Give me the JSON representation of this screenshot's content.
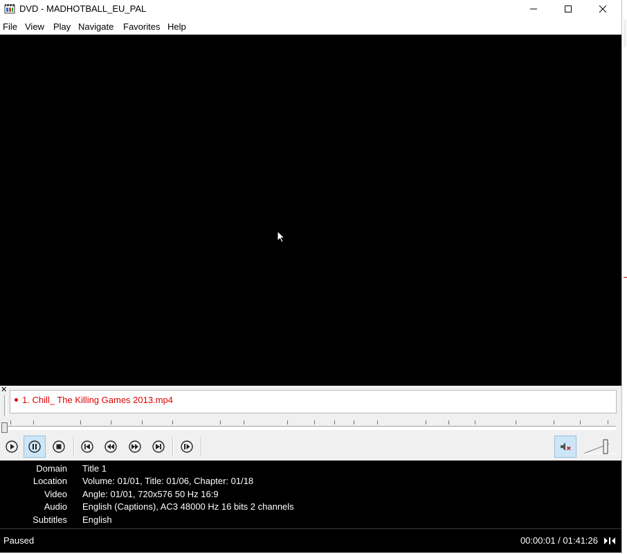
{
  "window": {
    "title": "DVD - MADHOTBALL_EU_PAL"
  },
  "menu": {
    "items": [
      "File",
      "View",
      "Play",
      "Navigate",
      "Favorites",
      "Help"
    ]
  },
  "playlist": {
    "items": [
      {
        "label": "1. Chill_ The Killing Games 2013.mp4",
        "color": "#e00000"
      }
    ]
  },
  "seek": {
    "position": 0.0002
  },
  "controls": {
    "buttons": [
      "play-icon",
      "pause-icon",
      "stop-icon",
      "skip-back-icon",
      "rewind-icon",
      "fast-forward-icon",
      "skip-forward-icon",
      "frame-step-icon"
    ],
    "active": "pause-icon",
    "mute_icon": "speaker-muted-icon"
  },
  "info": {
    "rows": [
      {
        "label": "Domain",
        "value": "Title 1"
      },
      {
        "label": "Location",
        "value": "Volume: 01/01, Title: 01/06, Chapter: 01/18"
      },
      {
        "label": "Video",
        "value": "Angle: 01/01, 720x576 50 Hz 16:9"
      },
      {
        "label": "Audio",
        "value": "English (Captions), AC3 48000 Hz 16 bits 2 channels"
      },
      {
        "label": "Subtitles",
        "value": "English"
      }
    ]
  },
  "status": {
    "state": "Paused",
    "time": "00:00:01 / 01:41:26"
  }
}
